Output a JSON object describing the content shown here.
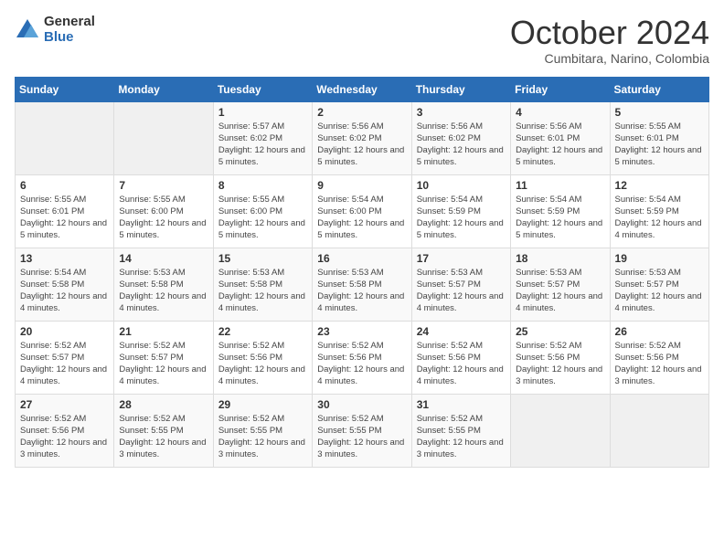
{
  "logo": {
    "general": "General",
    "blue": "Blue"
  },
  "title": "October 2024",
  "subtitle": "Cumbitara, Narino, Colombia",
  "days_of_week": [
    "Sunday",
    "Monday",
    "Tuesday",
    "Wednesday",
    "Thursday",
    "Friday",
    "Saturday"
  ],
  "weeks": [
    [
      {
        "day": "",
        "info": ""
      },
      {
        "day": "",
        "info": ""
      },
      {
        "day": "1",
        "info": "Sunrise: 5:57 AM\nSunset: 6:02 PM\nDaylight: 12 hours and 5 minutes."
      },
      {
        "day": "2",
        "info": "Sunrise: 5:56 AM\nSunset: 6:02 PM\nDaylight: 12 hours and 5 minutes."
      },
      {
        "day": "3",
        "info": "Sunrise: 5:56 AM\nSunset: 6:02 PM\nDaylight: 12 hours and 5 minutes."
      },
      {
        "day": "4",
        "info": "Sunrise: 5:56 AM\nSunset: 6:01 PM\nDaylight: 12 hours and 5 minutes."
      },
      {
        "day": "5",
        "info": "Sunrise: 5:55 AM\nSunset: 6:01 PM\nDaylight: 12 hours and 5 minutes."
      }
    ],
    [
      {
        "day": "6",
        "info": "Sunrise: 5:55 AM\nSunset: 6:01 PM\nDaylight: 12 hours and 5 minutes."
      },
      {
        "day": "7",
        "info": "Sunrise: 5:55 AM\nSunset: 6:00 PM\nDaylight: 12 hours and 5 minutes."
      },
      {
        "day": "8",
        "info": "Sunrise: 5:55 AM\nSunset: 6:00 PM\nDaylight: 12 hours and 5 minutes."
      },
      {
        "day": "9",
        "info": "Sunrise: 5:54 AM\nSunset: 6:00 PM\nDaylight: 12 hours and 5 minutes."
      },
      {
        "day": "10",
        "info": "Sunrise: 5:54 AM\nSunset: 5:59 PM\nDaylight: 12 hours and 5 minutes."
      },
      {
        "day": "11",
        "info": "Sunrise: 5:54 AM\nSunset: 5:59 PM\nDaylight: 12 hours and 5 minutes."
      },
      {
        "day": "12",
        "info": "Sunrise: 5:54 AM\nSunset: 5:59 PM\nDaylight: 12 hours and 4 minutes."
      }
    ],
    [
      {
        "day": "13",
        "info": "Sunrise: 5:54 AM\nSunset: 5:58 PM\nDaylight: 12 hours and 4 minutes."
      },
      {
        "day": "14",
        "info": "Sunrise: 5:53 AM\nSunset: 5:58 PM\nDaylight: 12 hours and 4 minutes."
      },
      {
        "day": "15",
        "info": "Sunrise: 5:53 AM\nSunset: 5:58 PM\nDaylight: 12 hours and 4 minutes."
      },
      {
        "day": "16",
        "info": "Sunrise: 5:53 AM\nSunset: 5:58 PM\nDaylight: 12 hours and 4 minutes."
      },
      {
        "day": "17",
        "info": "Sunrise: 5:53 AM\nSunset: 5:57 PM\nDaylight: 12 hours and 4 minutes."
      },
      {
        "day": "18",
        "info": "Sunrise: 5:53 AM\nSunset: 5:57 PM\nDaylight: 12 hours and 4 minutes."
      },
      {
        "day": "19",
        "info": "Sunrise: 5:53 AM\nSunset: 5:57 PM\nDaylight: 12 hours and 4 minutes."
      }
    ],
    [
      {
        "day": "20",
        "info": "Sunrise: 5:52 AM\nSunset: 5:57 PM\nDaylight: 12 hours and 4 minutes."
      },
      {
        "day": "21",
        "info": "Sunrise: 5:52 AM\nSunset: 5:57 PM\nDaylight: 12 hours and 4 minutes."
      },
      {
        "day": "22",
        "info": "Sunrise: 5:52 AM\nSunset: 5:56 PM\nDaylight: 12 hours and 4 minutes."
      },
      {
        "day": "23",
        "info": "Sunrise: 5:52 AM\nSunset: 5:56 PM\nDaylight: 12 hours and 4 minutes."
      },
      {
        "day": "24",
        "info": "Sunrise: 5:52 AM\nSunset: 5:56 PM\nDaylight: 12 hours and 4 minutes."
      },
      {
        "day": "25",
        "info": "Sunrise: 5:52 AM\nSunset: 5:56 PM\nDaylight: 12 hours and 3 minutes."
      },
      {
        "day": "26",
        "info": "Sunrise: 5:52 AM\nSunset: 5:56 PM\nDaylight: 12 hours and 3 minutes."
      }
    ],
    [
      {
        "day": "27",
        "info": "Sunrise: 5:52 AM\nSunset: 5:56 PM\nDaylight: 12 hours and 3 minutes."
      },
      {
        "day": "28",
        "info": "Sunrise: 5:52 AM\nSunset: 5:55 PM\nDaylight: 12 hours and 3 minutes."
      },
      {
        "day": "29",
        "info": "Sunrise: 5:52 AM\nSunset: 5:55 PM\nDaylight: 12 hours and 3 minutes."
      },
      {
        "day": "30",
        "info": "Sunrise: 5:52 AM\nSunset: 5:55 PM\nDaylight: 12 hours and 3 minutes."
      },
      {
        "day": "31",
        "info": "Sunrise: 5:52 AM\nSunset: 5:55 PM\nDaylight: 12 hours and 3 minutes."
      },
      {
        "day": "",
        "info": ""
      },
      {
        "day": "",
        "info": ""
      }
    ]
  ]
}
